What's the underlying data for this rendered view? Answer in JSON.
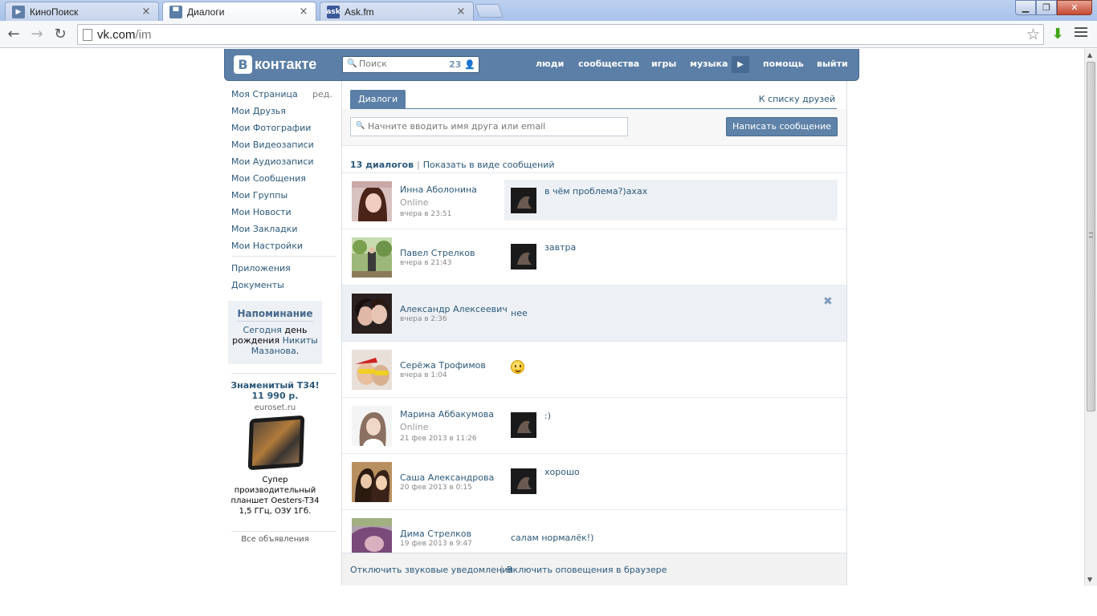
{
  "browser": {
    "tabs": [
      {
        "title": "КиноПоиск",
        "favicon": "kinopoisk-favicon",
        "active": false
      },
      {
        "title": "Диалоги",
        "favicon": "vk-messages-favicon",
        "active": true
      },
      {
        "title": "Ask.fm",
        "favicon": "askfm-favicon",
        "favicon_text": "ask",
        "active": false
      }
    ],
    "tab_close_glyph": "×",
    "url_host": "vk.com",
    "url_path": "/im"
  },
  "vk": {
    "logo_letter": "В",
    "logo_text": "контакте",
    "search_placeholder": "Поиск",
    "search_count": "23",
    "nav": {
      "people": "люди",
      "communities": "сообщества",
      "games": "игры",
      "music": "музыка",
      "help": "помощь",
      "logout": "выйти"
    },
    "colors": {
      "brand": "#5b7fa6",
      "link": "#2b587a",
      "hover_bg": "#edf1f5"
    }
  },
  "left_menu": {
    "items": [
      "Моя Страница",
      "Мои Друзья",
      "Мои Фотографии",
      "Мои Видеозаписи",
      "Мои Аудиозаписи",
      "Мои Сообщения",
      "Мои Группы",
      "Мои Новости",
      "Мои Закладки",
      "Мои Настройки"
    ],
    "edit": "ред.",
    "extra": [
      "Приложения",
      "Документы"
    ],
    "reminder": {
      "title": "Напоминание",
      "today": "Сегодня",
      "birthday_text": " день рождения ",
      "name": "Никиты Мазанова",
      "end": "."
    },
    "ad": {
      "title_line1": "Знаменитый T34!",
      "title_line2": "11 990 р.",
      "domain": "euroset.ru",
      "desc_line1": "Супер",
      "desc_line2": "производительный",
      "desc_line3": "планшет Oesters-T34",
      "desc_line4": "1,5 ГГц, ОЗУ 1Гб.",
      "all_ads": "Все объявления"
    }
  },
  "main": {
    "tab_dialogs": "Диалоги",
    "to_friends": "К списку друзей",
    "friend_search_placeholder": "Начните вводить имя друга или email",
    "write_button": "Написать сообщение",
    "dialog_count": "13 диалогов",
    "show_as_messages": "Показать в виде сообщений",
    "dialogs": [
      {
        "name": "Инна Аболонина",
        "status": "Online",
        "time": "вчера в 23:51",
        "text": "в чём проблема?)ахах",
        "from_me": true,
        "unread": true
      },
      {
        "name": "Павел Стрелков",
        "status": "",
        "time": "вчера в 21:43",
        "text": "завтра",
        "from_me": true,
        "unread": false
      },
      {
        "name": "Александр Алексеевич",
        "status": "",
        "time": "вчера в 2:36",
        "text": "нее",
        "from_me": false,
        "unread": false,
        "hover": true
      },
      {
        "name": "Серёжа Трофимов",
        "status": "",
        "time": "вчера в 1:04",
        "text": "",
        "emoji": "smile-emoji",
        "from_me": false,
        "unread": false
      },
      {
        "name": "Марина Аббакумова",
        "status": "Online",
        "time": "21 фев 2013 в 11:26",
        "text": ":)",
        "from_me": true,
        "unread": false
      },
      {
        "name": "Саша Александрова",
        "status": "",
        "time": "20 фев 2013 в 0:15",
        "text": "хорошо",
        "from_me": true,
        "unread": false
      },
      {
        "name": "Дима Стрелков",
        "status": "",
        "time": "19 фев 2013 в 9:47",
        "text": "салам нормалёк!)",
        "from_me": false,
        "unread": false
      }
    ],
    "delete_glyph": "✖",
    "footer": {
      "sound": "Отключить звуковые уведомления",
      "browser": "Включить оповещения в браузере"
    }
  }
}
